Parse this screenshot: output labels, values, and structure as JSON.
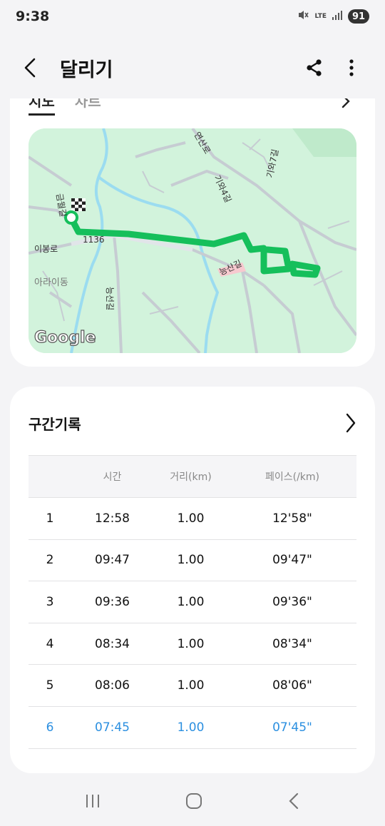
{
  "status": {
    "time": "9:38",
    "network": "LTE",
    "battery": "91"
  },
  "header": {
    "title": "달리기"
  },
  "tabs": [
    {
      "label": "지도"
    },
    {
      "label": "차트"
    }
  ],
  "map": {
    "labels": {
      "gumwol": "금월길",
      "route_num": "1136",
      "ibong": "이봉로",
      "araidong": "아라이동",
      "neungseon": "능선길",
      "yeonsin": "연산로",
      "gia4": "기와4길",
      "gia": "기와7길",
      "neungsan": "능산길"
    },
    "attribution": "Google",
    "colors": {
      "background": "#d2f3dc",
      "route": "#15bf5b",
      "river": "#9bdcf0",
      "road": "#c6ccd2"
    }
  },
  "splits": {
    "title": "구간기록",
    "columns": {
      "index": "",
      "time": "시간",
      "distance": "거리(km)",
      "pace": "페이스(/km)"
    },
    "rows": [
      {
        "index": "1",
        "time": "12:58",
        "distance": "1.00",
        "pace": "12'58\""
      },
      {
        "index": "2",
        "time": "09:47",
        "distance": "1.00",
        "pace": "09'47\""
      },
      {
        "index": "3",
        "time": "09:36",
        "distance": "1.00",
        "pace": "09'36\""
      },
      {
        "index": "4",
        "time": "08:34",
        "distance": "1.00",
        "pace": "08'34\""
      },
      {
        "index": "5",
        "time": "08:06",
        "distance": "1.00",
        "pace": "08'06\""
      },
      {
        "index": "6",
        "time": "07:45",
        "distance": "1.00",
        "pace": "07'45\""
      }
    ],
    "highlight_color": "#2b8fe0"
  },
  "navbar": {
    "icons": [
      "recent-apps-icon",
      "home-icon",
      "back-icon"
    ]
  }
}
